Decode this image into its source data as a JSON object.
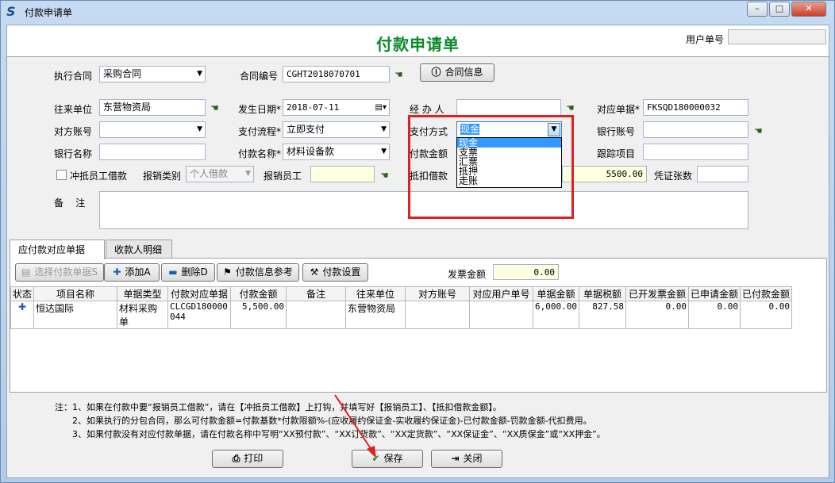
{
  "window": {
    "title": "付款申请单",
    "controls": {
      "minimize": "–",
      "maximize": "□",
      "close": "✕"
    }
  },
  "header": {
    "title": "付款申请单",
    "user_no_label": "用户单号",
    "user_no_value": ""
  },
  "form": {
    "exec_contract_label": "执行合同",
    "exec_contract_value": "采购合同",
    "contract_no_label": "合同编号",
    "contract_no_value": "CGHT2018070701",
    "contract_info_button": "合同信息",
    "partner_label": "往来单位",
    "partner_value": "东营物资局",
    "date_label": "发生日期*",
    "date_value": "2018-07-11",
    "handler_label": "经 办 人",
    "handler_value": "",
    "related_doc_label": "对应单据*",
    "related_doc_value": "FKSQD180000032",
    "counter_account_label": "对方账号",
    "counter_account_value": "",
    "pay_flow_label": "支付流程*",
    "pay_flow_value": "立即支付",
    "pay_method_label": "支付方式",
    "pay_method_value": "现金",
    "bank_account_label": "银行账号",
    "bank_account_value": "",
    "bank_name_label": "银行名称",
    "bank_name_value": "",
    "pay_name_label": "付款名称*",
    "pay_name_value": "材料设备款",
    "pay_amount_label": "付款金额",
    "tracking_label": "跟踪项目",
    "tracking_value": "",
    "offset_loan_label": "冲抵员工借款",
    "reimb_type_label": "报销类别",
    "reimb_type_value": "个人借款",
    "reimb_employee_label": "报销员工",
    "reimb_employee_value": "",
    "deduct_loan_label": "抵扣借款",
    "deduct_loan_value": "5500.00",
    "voucher_count_label": "凭证张数",
    "voucher_count_value": "",
    "remark_label": "备    注",
    "remark_value": ""
  },
  "dropdown": {
    "options": [
      "现金",
      "支票",
      "汇票",
      "抵押",
      "走账"
    ],
    "selected_index": 0
  },
  "tabs": [
    {
      "label": "应付款对应单据",
      "active": true
    },
    {
      "label": "收款人明细",
      "active": false
    }
  ],
  "toolbar": {
    "select_docs": "选择付款单据S",
    "add": "添加A",
    "delete": "删除D",
    "pay_info_ref": "付款信息参考",
    "pay_settings": "付款设置",
    "invoice_amount_label": "发票金额",
    "invoice_amount_value": "0.00"
  },
  "table": {
    "columns": [
      "状态",
      "项目名称",
      "单据类型",
      "付款对应单据",
      "付款金额",
      "备注",
      "往来单位",
      "对方账号",
      "对应用户单号",
      "单据金额",
      "单据税额",
      "已开发票金额",
      "已申请金额",
      "已付款金额"
    ],
    "rows": [
      {
        "status_icon": "plus-icon",
        "project": "恒达国际",
        "doc_type": "材料采购单",
        "pay_doc": "CLCGD180000044",
        "pay_amount": "5,500.00",
        "remark": "",
        "partner": "东营物资局",
        "counter_account": "",
        "user_no": "",
        "doc_amount": "6,000.00",
        "doc_tax": "827.58",
        "invoiced": "0.00",
        "applied": "0.00",
        "paid": "0.00"
      }
    ]
  },
  "notes": [
    "注：1、如果在付款中要“报销员工借款”，请在【冲抵员工借款】上打钩，并填写好【报销员工】、【抵扣借款金额】。",
    "2、如果执行的分包合同，那么可付款金额=付款基数*付款限额%-(应收履约保证金-实收履约保证金)-已付款金额-罚款金额-代扣费用。",
    "3、如果付款没有对应付款单据，请在付款名称中写明“XX预付款”、“XX订货款”、“XX定货款”、“XX保证金”、“XX质保金”或“XX押金”。"
  ],
  "footer": {
    "print": "打印",
    "save": "保存",
    "close": "关闭"
  },
  "colors": {
    "title_green": "#0a8a2a",
    "highlight_red": "#e02020",
    "selection_blue": "#3399ff",
    "annotation_arrow": "#e02020"
  }
}
